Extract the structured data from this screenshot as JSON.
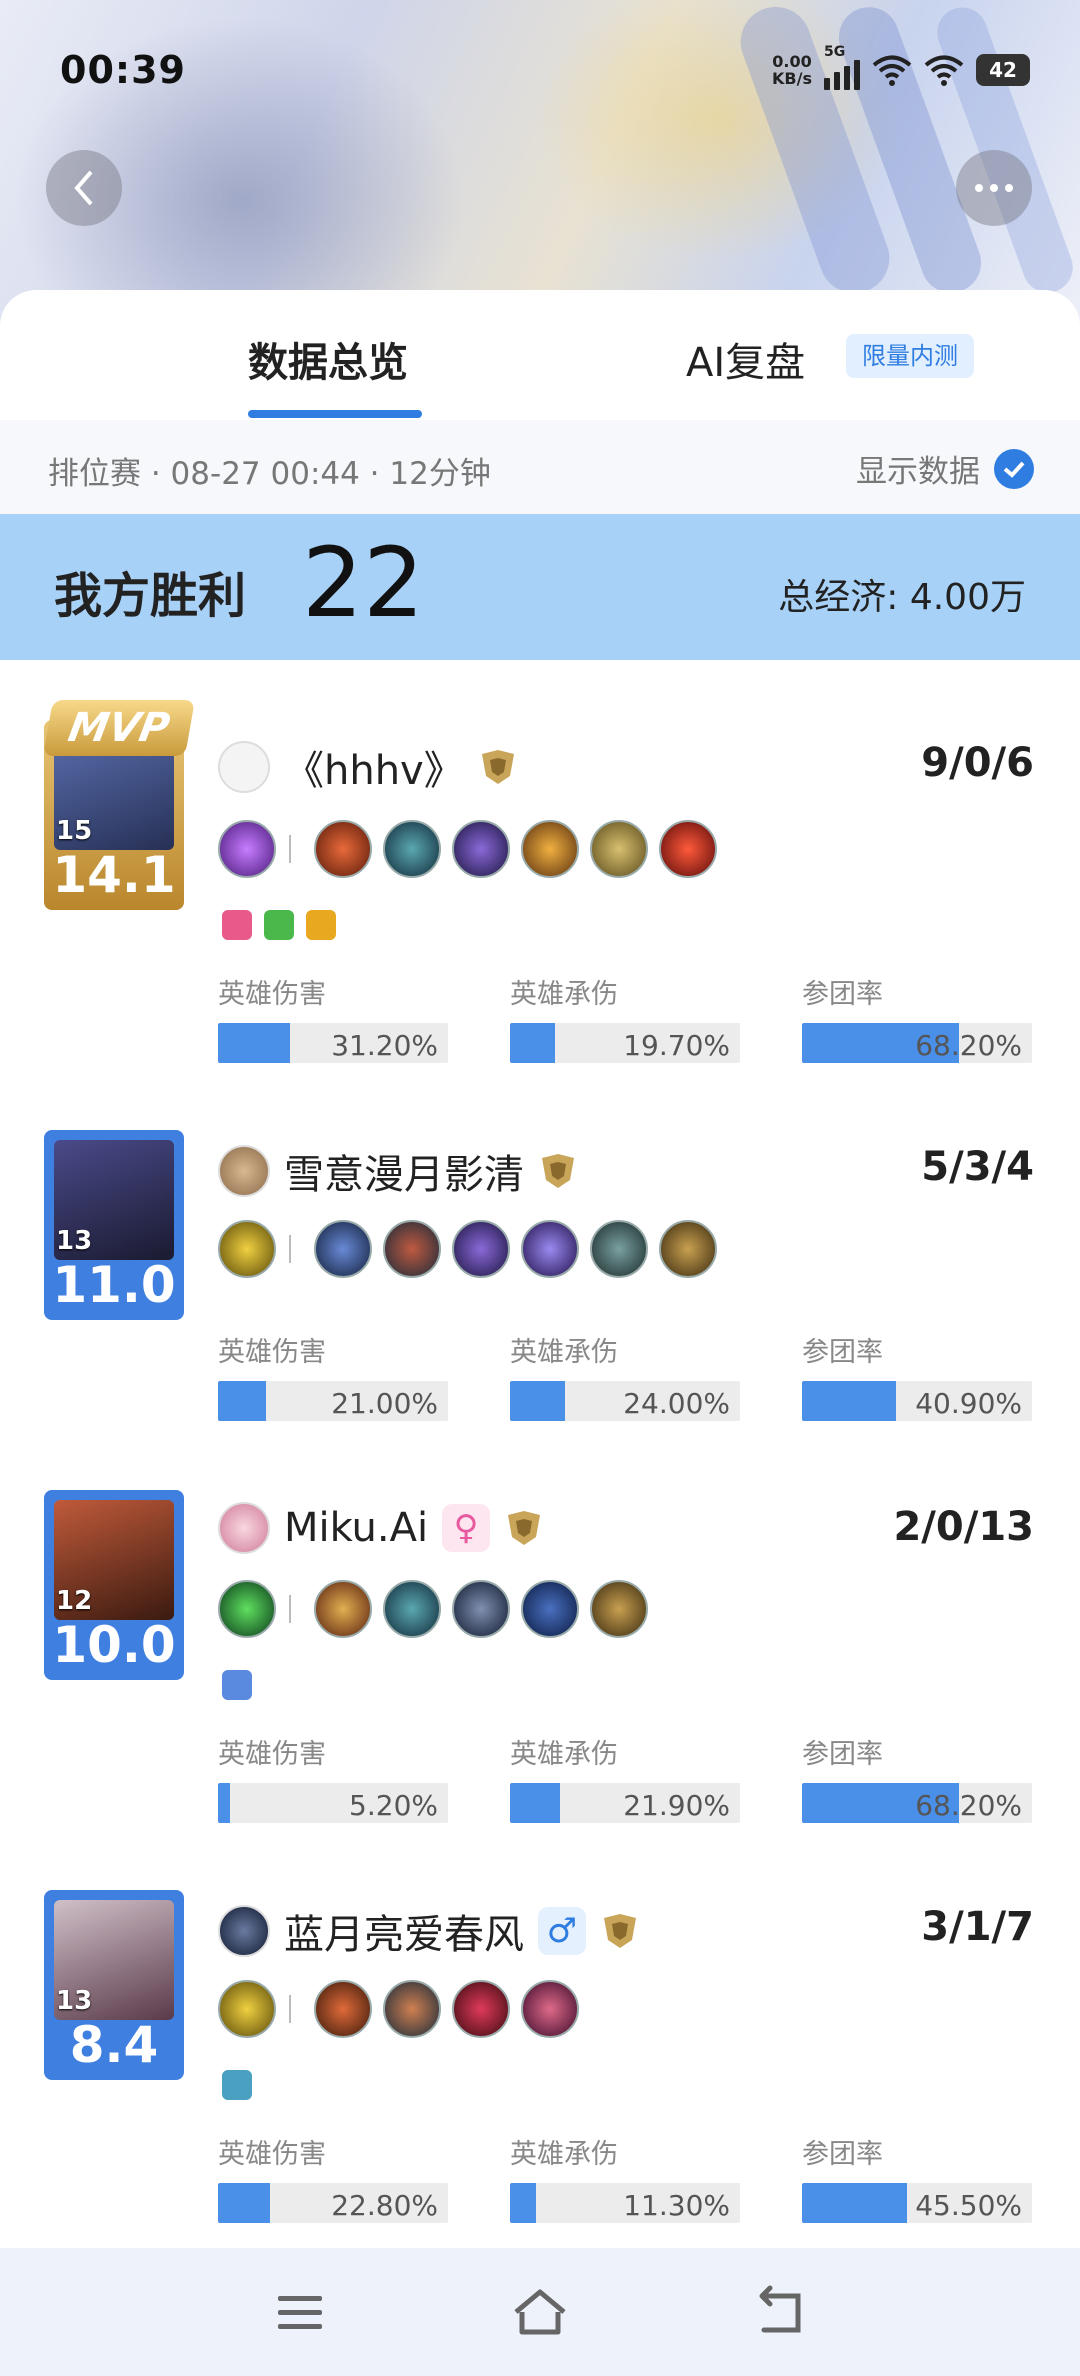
{
  "status": {
    "time": "00:39",
    "net_speed_value": "0.00",
    "net_speed_unit": "KB/s",
    "network": "5G",
    "battery": "42"
  },
  "tabs": [
    {
      "label": "数据总览",
      "active": true
    },
    {
      "label": "AI复盘",
      "badge": "限量内测",
      "active": false
    }
  ],
  "meta": {
    "info": "排位赛 · 08-27 00:44 · 12分钟",
    "show_data_label": "显示数据",
    "show_data_checked": true
  },
  "result": {
    "label": "我方胜利",
    "score": "22",
    "economy": "总经济: 4.00万"
  },
  "stat_labels": {
    "damage": "英雄伤害",
    "taken": "英雄承伤",
    "participation": "参团率"
  },
  "players": [
    {
      "mvp": "MVP",
      "level": "15",
      "rating": "14.1",
      "name": "《hhhv》",
      "kda": "9/0/6",
      "gender": "",
      "equip_count": 6,
      "stats": {
        "damage": {
          "text": "31.20%",
          "value": 31.2
        },
        "taken": {
          "text": "19.70%",
          "value": 19.7
        },
        "participation": {
          "text": "68.20%",
          "value": 68.2
        }
      }
    },
    {
      "mvp": "",
      "level": "13",
      "rating": "11.0",
      "name": "雪意漫月影清",
      "kda": "5/3/4",
      "gender": "",
      "equip_count": 6,
      "stats": {
        "damage": {
          "text": "21.00%",
          "value": 21.0
        },
        "taken": {
          "text": "24.00%",
          "value": 24.0
        },
        "participation": {
          "text": "40.90%",
          "value": 40.9
        }
      }
    },
    {
      "mvp": "",
      "level": "12",
      "rating": "10.0",
      "name": "Miku.Ai",
      "kda": "2/0/13",
      "gender": "♀",
      "equip_count": 5,
      "stats": {
        "damage": {
          "text": "5.20%",
          "value": 5.2
        },
        "taken": {
          "text": "21.90%",
          "value": 21.9
        },
        "participation": {
          "text": "68.20%",
          "value": 68.2
        }
      }
    },
    {
      "mvp": "",
      "level": "13",
      "rating": "8.4",
      "name": "蓝月亮爱春风",
      "kda": "3/1/7",
      "gender": "♂",
      "equip_count": 4,
      "stats": {
        "damage": {
          "text": "22.80%",
          "value": 22.8
        },
        "taken": {
          "text": "11.30%",
          "value": 11.3
        },
        "participation": {
          "text": "45.50%",
          "value": 45.5
        }
      }
    }
  ],
  "colors": {
    "accent": "#2f7de1",
    "bar": "#4a8fe8",
    "banner": "#a7d1f7",
    "mvp_card": "#d4a64a",
    "card": "#3f7fe0"
  }
}
